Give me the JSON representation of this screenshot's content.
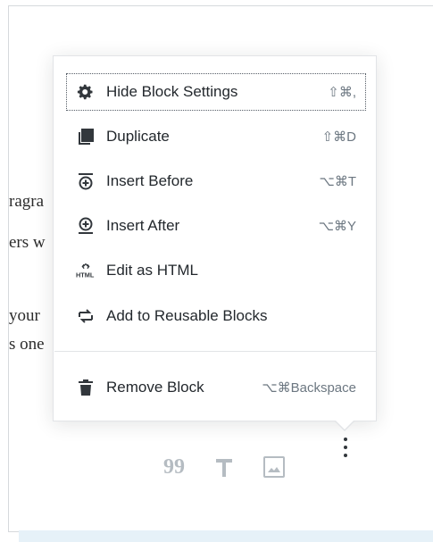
{
  "background_text": {
    "lines": [
      "ragra",
      "ers w",
      "",
      "your",
      "s one"
    ]
  },
  "menu": {
    "items": [
      {
        "label": "Hide Block Settings",
        "shortcut": "⇧⌘,",
        "icon": "gear-icon"
      },
      {
        "label": "Duplicate",
        "shortcut": "⇧⌘D",
        "icon": "duplicate-icon"
      },
      {
        "label": "Insert Before",
        "shortcut": "⌥⌘T",
        "icon": "insert-before-icon"
      },
      {
        "label": "Insert After",
        "shortcut": "⌥⌘Y",
        "icon": "insert-after-icon"
      },
      {
        "label": "Edit as HTML",
        "shortcut": "",
        "icon": "html-icon"
      },
      {
        "label": "Add to Reusable Blocks",
        "shortcut": "",
        "icon": "reusable-block-icon"
      }
    ],
    "remove": {
      "label": "Remove Block",
      "shortcut": "⌥⌘Backspace",
      "icon": "trash-icon"
    }
  },
  "html_icon_text": "HTML",
  "toolbar": {
    "icons": [
      "quote-icon",
      "heading-icon",
      "image-icon",
      "more-options-icon"
    ]
  },
  "colors": {
    "accent_strip": "#e6f1f8",
    "icon_dark": "#32373c",
    "icon_muted": "#b5bcc2"
  }
}
